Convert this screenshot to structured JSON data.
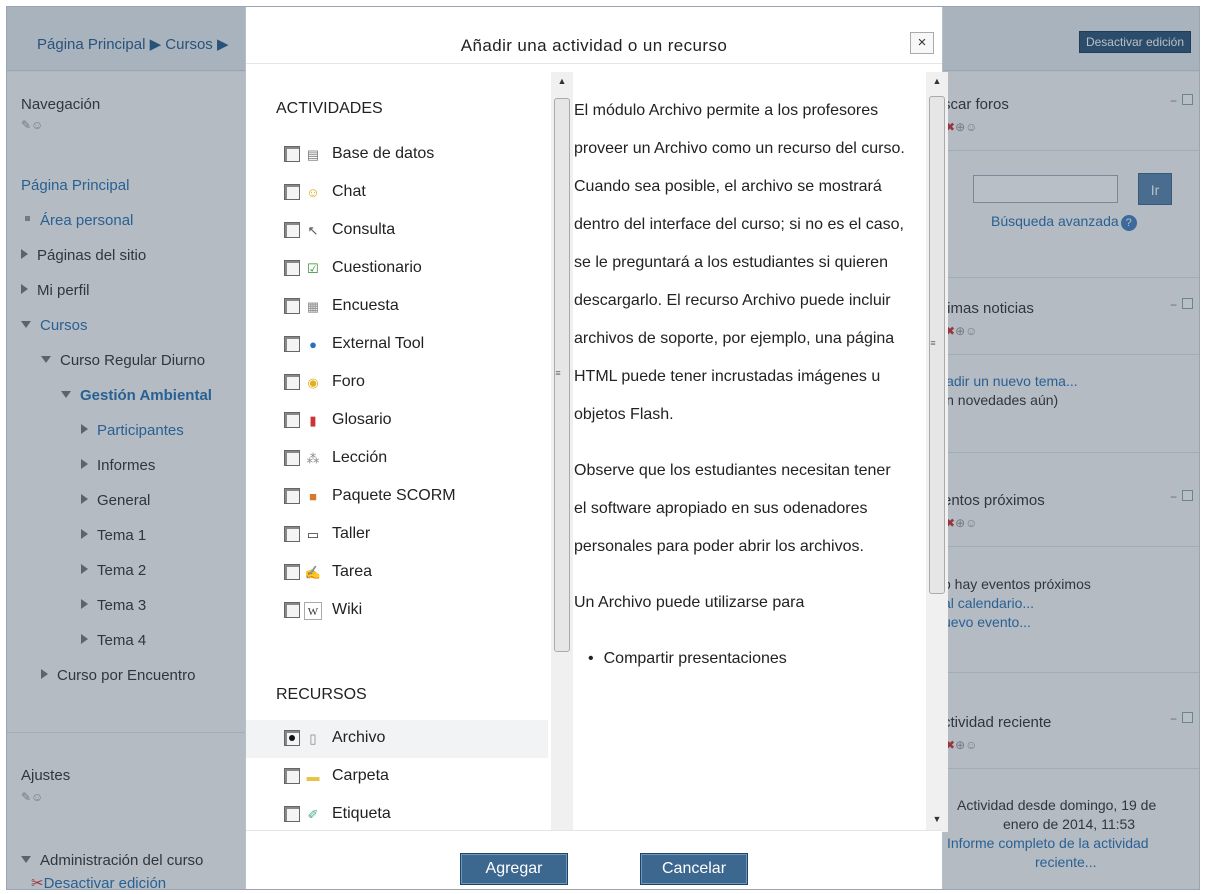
{
  "page": {
    "breadcrumb": "Página Principal ▶ Cursos ▶",
    "edit_toggle": "Desactivar edición"
  },
  "navigation": {
    "title": "Navegación",
    "home": "Página Principal",
    "items": [
      "Área personal",
      "Páginas del sitio",
      "Mi perfil",
      "Cursos",
      "Curso Regular Diurno",
      "Gestión Ambiental",
      "Participantes",
      "Informes",
      "General",
      "Tema 1",
      "Tema 2",
      "Tema 3",
      "Tema 4",
      "Curso por Encuentro"
    ]
  },
  "settings": {
    "title": "Ajustes",
    "items": [
      "Administración del curso",
      "Desactivar edición"
    ]
  },
  "right_blocks": {
    "search": {
      "title": "scar foros",
      "go": "Ir",
      "advanced": "Búsqueda avanzada"
    },
    "news": {
      "title": "timas noticias",
      "add": "iadir un nuevo tema...",
      "none": "in novedades aún)"
    },
    "events": {
      "title": "entos próximos",
      "none": "o hay eventos próximos",
      "calendar": "al calendario...",
      "new": "uevo evento..."
    },
    "activity": {
      "title": "ctividad reciente",
      "since1": "Actividad desde domingo, 19 de",
      "since2": "enero de 2014, 11:53",
      "report1": "Informe completo de la actividad",
      "report2": "reciente..."
    }
  },
  "dialog": {
    "title": "Añadir una actividad o un recurso",
    "close": "×",
    "activities_title": "ACTIVIDADES",
    "activities": [
      {
        "label": "Base de datos",
        "icon": "database-icon"
      },
      {
        "label": "Chat",
        "icon": "chat-icon"
      },
      {
        "label": "Consulta",
        "icon": "choice-icon"
      },
      {
        "label": "Cuestionario",
        "icon": "quiz-icon"
      },
      {
        "label": "Encuesta",
        "icon": "survey-icon"
      },
      {
        "label": "External Tool",
        "icon": "globe-icon"
      },
      {
        "label": "Foro",
        "icon": "forum-icon"
      },
      {
        "label": "Glosario",
        "icon": "glossary-icon"
      },
      {
        "label": "Lección",
        "icon": "lesson-icon"
      },
      {
        "label": "Paquete SCORM",
        "icon": "scorm-icon"
      },
      {
        "label": "Taller",
        "icon": "workshop-icon"
      },
      {
        "label": "Tarea",
        "icon": "assignment-icon"
      },
      {
        "label": "Wiki",
        "icon": "wiki-icon"
      }
    ],
    "resources_title": "RECURSOS",
    "resources": [
      {
        "label": "Archivo",
        "icon": "file-icon",
        "selected": true
      },
      {
        "label": "Carpeta",
        "icon": "folder-icon"
      },
      {
        "label": "Etiqueta",
        "icon": "label-icon"
      }
    ],
    "help_paragraphs": [
      "El módulo Archivo permite a los profesores proveer un Archivo como un recurso del curso. Cuando sea posible, el archivo se mostrará dentro del interface del curso; si no es el caso, se le preguntará a los estudiantes si quieren descargarlo. El recurso Archivo puede incluir archivos de soporte, por ejemplo, una página HTML puede tener incrustadas imágenes u objetos Flash.",
      "Observe que los estudiantes necesitan tener el software apropiado en sus odenadores personales para poder abrir los archivos.",
      "Un Archivo puede utilizarse para"
    ],
    "help_bullets": [
      "Compartir presentaciones"
    ],
    "add_button": "Agregar",
    "cancel_button": "Cancelar"
  }
}
